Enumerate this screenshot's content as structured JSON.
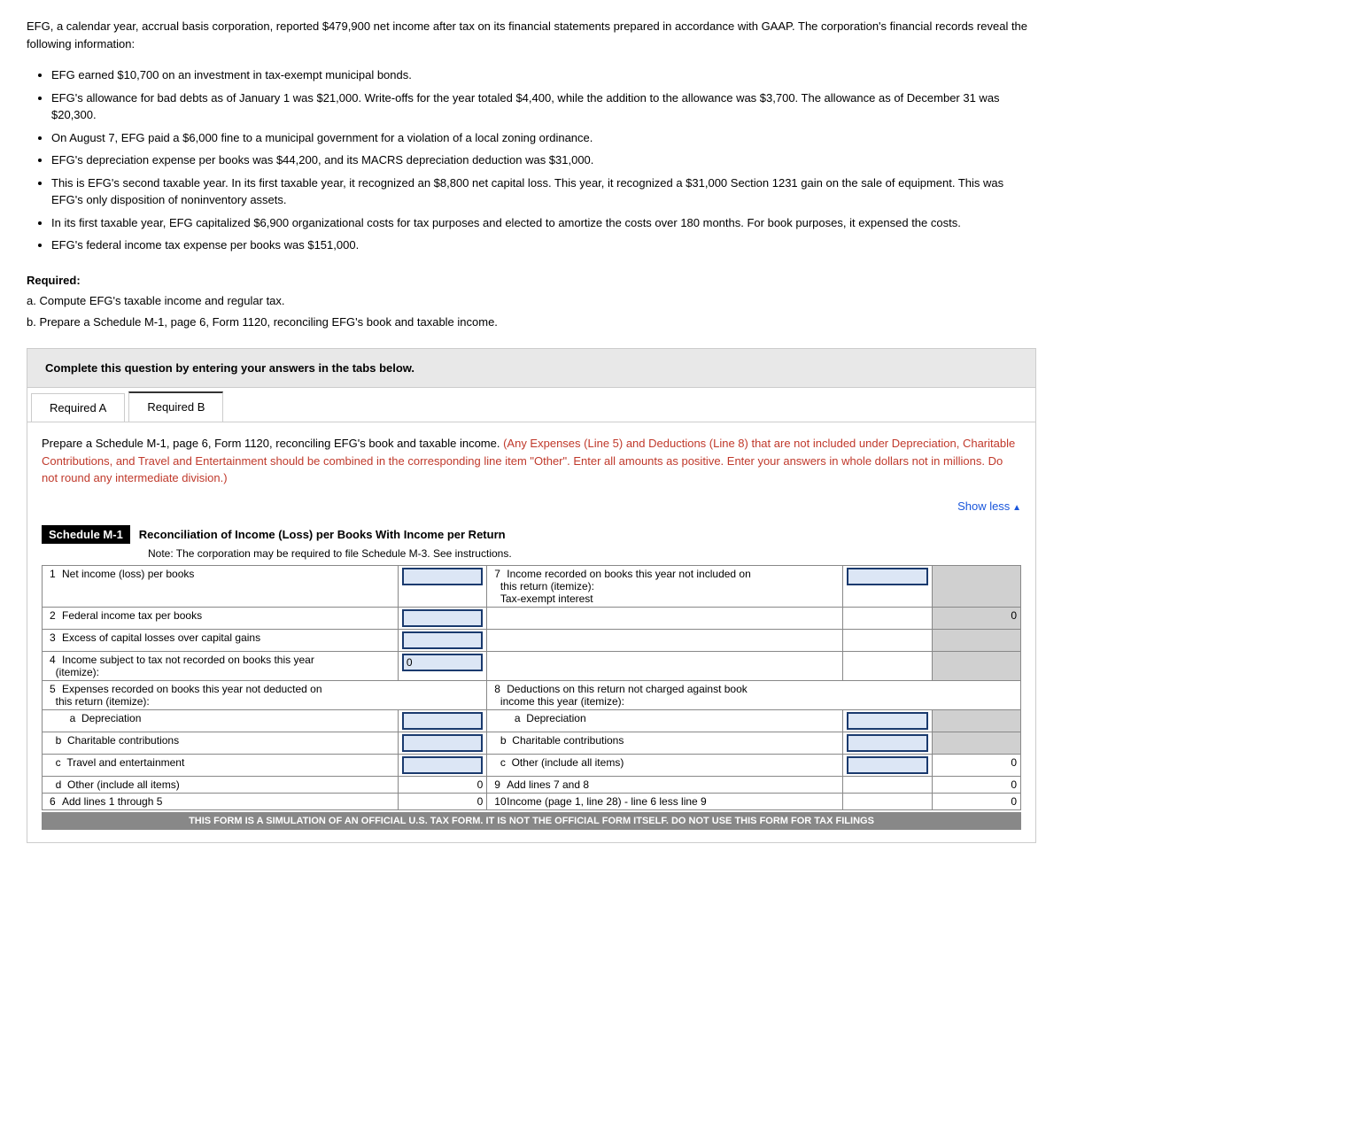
{
  "intro": {
    "paragraph": "EFG, a calendar year, accrual basis corporation, reported $479,900 net income after tax on its financial statements prepared in accordance with GAAP. The corporation's financial records reveal the following information:"
  },
  "bullets": [
    "EFG earned $10,700 on an investment in tax-exempt municipal bonds.",
    "EFG's allowance for bad debts as of January 1 was $21,000. Write-offs for the year totaled $4,400, while the addition to the allowance was $3,700. The allowance as of December 31 was $20,300.",
    "On August 7, EFG paid a $6,000 fine to a municipal government for a violation of a local zoning ordinance.",
    "EFG's depreciation expense per books was $44,200, and its MACRS depreciation deduction was $31,000.",
    "This is EFG's second taxable year. In its first taxable year, it recognized an $8,800 net capital loss. This year, it recognized a $31,000 Section 1231 gain on the sale of equipment. This was EFG's only disposition of noninventory assets.",
    "In its first taxable year, EFG capitalized $6,900 organizational costs for tax purposes and elected to amortize the costs over 180 months. For book purposes, it expensed the costs.",
    "EFG's federal income tax expense per books was $151,000."
  ],
  "required": {
    "label": "Required:",
    "part_a": "a. Compute EFG's taxable income and regular tax.",
    "part_b": "b. Prepare a Schedule M-1, page 6, Form 1120, reconciling EFG's book and taxable income."
  },
  "question_box": {
    "text": "Complete this question by entering your answers in the tabs below."
  },
  "tabs": [
    {
      "id": "req-a",
      "label": "Required A"
    },
    {
      "id": "req-b",
      "label": "Required B"
    }
  ],
  "active_tab": "Required B",
  "tab_content": {
    "instruction_normal": "Prepare a Schedule M-1, page 6, Form 1120, reconciling EFG's book and taxable income.",
    "instruction_highlight": "(Any Expenses (Line 5) and Deductions (Line 8) that are not included under Depreciation, Charitable Contributions, and Travel and Entertainment should be combined in the corresponding line item \"Other\". Enter all amounts as positive. Enter your answers in whole dollars not in millions. Do not round any intermediate division.)"
  },
  "show_less": "Show less",
  "schedule": {
    "badge": "Schedule M-1",
    "title": "Reconciliation of Income (Loss) per Books With Income per Return",
    "note": "Note: The corporation may be required to file Schedule M-3. See instructions.",
    "rows_left": [
      {
        "num": "1",
        "label": "Net income (loss) per books",
        "input": true
      },
      {
        "num": "2",
        "label": "Federal income tax per books",
        "input": true
      },
      {
        "num": "3",
        "label": "Excess of capital losses over capital gains",
        "input": true
      },
      {
        "num": "4",
        "label": "Income subject to tax not recorded on books this year",
        "label2": "(itemize):",
        "input": true,
        "value": "0"
      },
      {
        "num": "5",
        "label": "Expenses recorded on books this year not deducted on",
        "label2": "this return (itemize):",
        "sub": [
          {
            "id": "a",
            "label": "Depreciation",
            "input": true
          },
          {
            "id": "b",
            "label": "Charitable contributions",
            "input": true
          },
          {
            "id": "c",
            "label": "Travel and entertainment",
            "input": true
          },
          {
            "id": "d",
            "label": "Other (include all items)",
            "input": false,
            "value": "0"
          }
        ]
      },
      {
        "num": "6",
        "label": "Add lines 1 through 5",
        "value": "0"
      }
    ],
    "rows_right": [
      {
        "num": "7",
        "label": "Income recorded on books this year not included on",
        "label2": "this return (itemize):",
        "label3": "Tax-exempt interest",
        "input": true,
        "input2": true,
        "value": "0"
      },
      {
        "num": "8",
        "label": "Deductions on this return not charged against book",
        "label2": "income this year (itemize):",
        "sub": [
          {
            "id": "a",
            "label": "Depreciation",
            "input": true
          },
          {
            "id": "b",
            "label": "Charitable contributions",
            "input": true
          },
          {
            "id": "c",
            "label": "Other (include all items)",
            "input": true,
            "value": "0"
          }
        ]
      },
      {
        "num": "9",
        "label": "Add lines 7 and 8",
        "value": "0"
      },
      {
        "num": "10",
        "label": "Income (page 1, line 28) - line 6 less line 9",
        "value": "0"
      }
    ],
    "footer": "THIS FORM IS A SIMULATION OF AN OFFICIAL U.S. TAX FORM. IT IS NOT THE OFFICIAL FORM ITSELF. DO NOT USE THIS FORM FOR TAX FILINGS"
  }
}
